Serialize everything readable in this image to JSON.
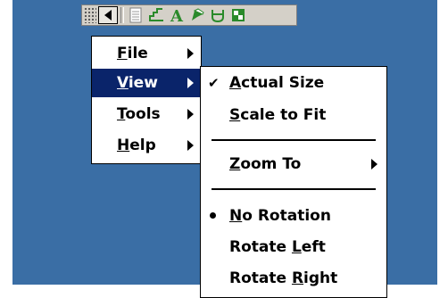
{
  "toolbar": {
    "buttons": [
      {
        "icon": "back-arrow-icon"
      },
      {
        "icon": "page-icon"
      },
      {
        "icon": "pencil-icon"
      },
      {
        "icon": "text-tool-icon"
      },
      {
        "icon": "highlighter-icon"
      },
      {
        "icon": "shape-icon"
      },
      {
        "icon": "window-icon"
      }
    ]
  },
  "menu": {
    "file": {
      "m": "F",
      "rest": "ile"
    },
    "view": {
      "m": "V",
      "rest": "iew"
    },
    "tools": {
      "m": "T",
      "rest": "ools"
    },
    "help": {
      "m": "H",
      "rest": "elp"
    }
  },
  "view_submenu": {
    "actual_size": {
      "m": "A",
      "rest": "ctual Size"
    },
    "scale_to_fit": {
      "m": "S",
      "rest": "cale to Fit"
    },
    "zoom_to": {
      "m": "Z",
      "rest": "oom To"
    },
    "no_rotation": {
      "m": "N",
      "rest": "o Rotation"
    },
    "rotate_left": {
      "pre": "Rotate ",
      "m": "L",
      "rest": "eft"
    },
    "rotate_right": {
      "pre": "Rotate ",
      "m": "R",
      "rest": "ight"
    }
  },
  "colors": {
    "desktop": "#3a6ea5",
    "highlight": "#0a246a"
  }
}
